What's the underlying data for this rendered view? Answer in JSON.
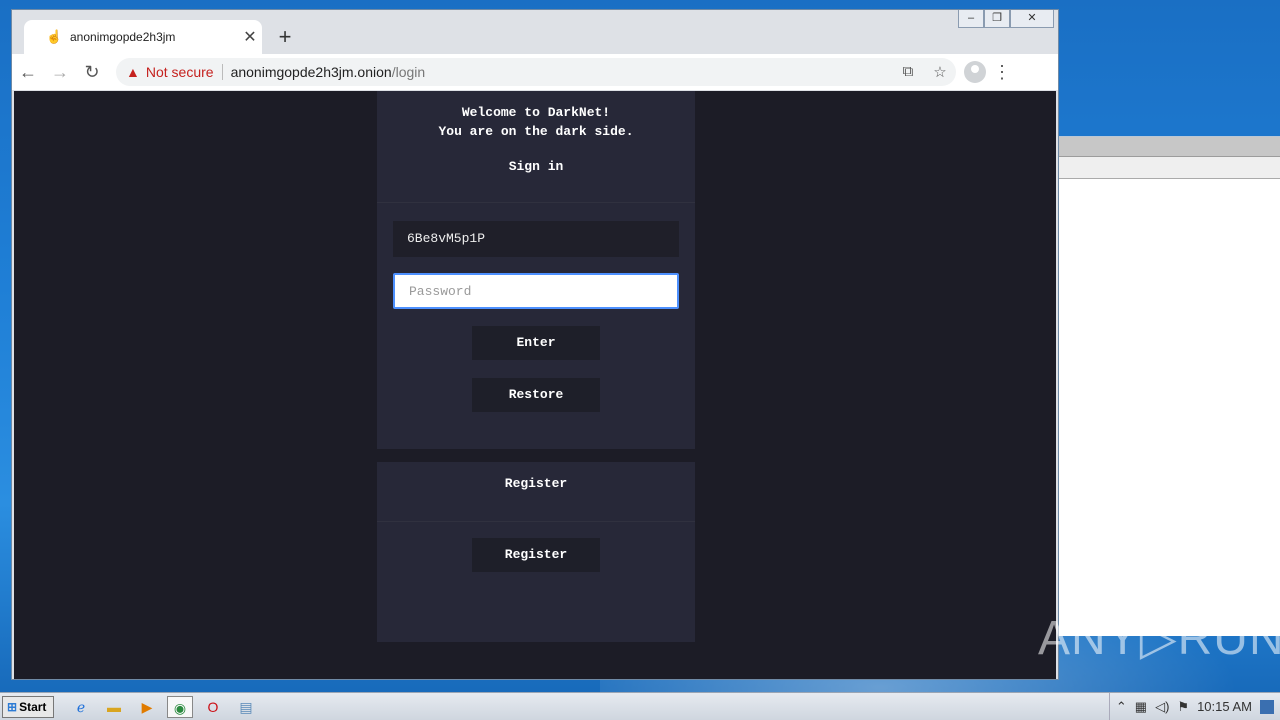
{
  "browser": {
    "tab_title": "anonimgopde2h3jm",
    "new_tab_symbol": "+",
    "close_symbol": "✕",
    "security_label": "Not secure",
    "url_host": "anonimgopde2h3jm.onion",
    "url_path": "/login"
  },
  "page": {
    "welcome_line1": "Welcome to DarkNet!",
    "welcome_line2": "You are on the dark side.",
    "signin_heading": "Sign in",
    "username_value": "6Be8vM5p1P",
    "password_placeholder": "Password",
    "enter_label": "Enter",
    "restore_label": "Restore",
    "register_heading": "Register",
    "register_label": "Register"
  },
  "watermark": "ANY▷RUN",
  "taskbar": {
    "start_label": "Start",
    "clock": "10:15 AM"
  },
  "colors": {
    "page_bg": "#1c1c26",
    "panel_bg": "#272838",
    "button_bg": "#1e1f29",
    "warning_red": "#c5221f",
    "focus_blue": "#4d90fe"
  }
}
